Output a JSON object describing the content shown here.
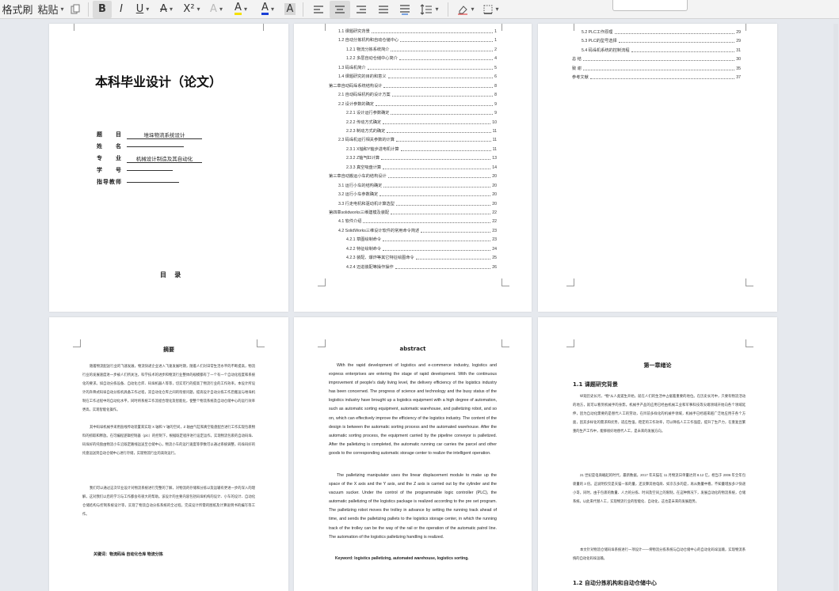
{
  "ribbon": {
    "format_painter": "格式刷",
    "paste": "粘贴",
    "bold": "B",
    "italic": "I",
    "underline": "U",
    "strikethrough": "A",
    "superscript": "X²",
    "text_effect": "A",
    "highlight": "A",
    "font_color": "A",
    "char_shading": "A",
    "caret": "▾"
  },
  "page_cover": {
    "title": "本科毕业设计（论文）",
    "fields": [
      {
        "label": "题　　目",
        "value": "堆垛物流系统设计"
      },
      {
        "label": "姓　　名",
        "value": ""
      },
      {
        "label": "专　　业",
        "value": "机械设计制造及其自动化"
      },
      {
        "label": "学　　号",
        "value": ""
      },
      {
        "label": "指导教师",
        "value": ""
      }
    ],
    "toc_heading": "目 录"
  },
  "page_toc1": {
    "entries": [
      {
        "text": "1.1 课题研究背景",
        "page": "1"
      },
      {
        "text": "1.2 自动分拣机构和自动仓储中心",
        "page": "1"
      },
      {
        "text": "1.2.1 物流分拣系统简介",
        "page": "2"
      },
      {
        "text": "1.2.2 多层自动仓储中心简介",
        "page": "4"
      },
      {
        "text": "1.3 码垛机简介",
        "page": "5"
      },
      {
        "text": "1.4 课题研究的目的和意义",
        "page": "6"
      },
      {
        "text": "第二章自动码垛系统结构设计",
        "page": "8"
      },
      {
        "text": "2.1 自动码垛机构的设计方案",
        "page": "8"
      },
      {
        "text": "2.2 设计参数的确定",
        "page": "9"
      },
      {
        "text": "2.2.1 设计运行参数确定",
        "page": "9"
      },
      {
        "text": "2.2.2 传动方式确定",
        "page": "10"
      },
      {
        "text": "2.2.3 制动方式的确定",
        "page": "11"
      },
      {
        "text": "2.3 码垛机运行相关参数的计算",
        "page": "11"
      },
      {
        "text": "2.3.1 X轴和Y轴步进电机计算",
        "page": "11"
      },
      {
        "text": "2.3.2 Z轴气缸计算",
        "page": "13"
      },
      {
        "text": "2.3.3 真空吸盘计算",
        "page": "14"
      },
      {
        "text": "第三章自动搬运小车的结构设计",
        "page": "20"
      },
      {
        "text": "3.1 运行小车的结构确定",
        "page": "20"
      },
      {
        "text": "3.2 运行小车参数确定",
        "page": "20"
      },
      {
        "text": "3.3 行走电机和驱动机计算选型",
        "page": "20"
      },
      {
        "text": "第四章solidworks三维建模及装配",
        "page": "22"
      },
      {
        "text": "4.1 软件介绍",
        "page": "22"
      },
      {
        "text": "4.2 SolidWorks三维设计软件的常用命令简述",
        "page": "23"
      },
      {
        "text": "4.2.1 草图绘制命令",
        "page": "23"
      },
      {
        "text": "4.2.2 特征绘制命令",
        "page": "24"
      },
      {
        "text": "4.2.3 装配、爆炸等其它特征绘图命令",
        "page": "25"
      },
      {
        "text": "4.2.4 迈进装配等操作操作",
        "page": "26"
      }
    ]
  },
  "page_toc2": {
    "entries": [
      {
        "text": "5.2 PLC工作原理",
        "page": "29"
      },
      {
        "text": "5.3 PLC的型号选择",
        "page": "29"
      },
      {
        "text": "5.4 码垛机系统的控制流程",
        "page": "31"
      },
      {
        "text": "总 结",
        "page": "30"
      },
      {
        "text": "致 谢",
        "page": "35"
      },
      {
        "text": "参考文献",
        "page": "37"
      }
    ]
  },
  "page_abstract_cn": {
    "heading": "摘要",
    "paragraphs": [
      "随着物流配送行业的飞速发展，物流快递企业进入飞速发展时期，随着人们对日常生活水平的不断提高，物流行业的发展速度进一步被人们所关注，科学技术的进步和物流行业整体的规模都有了一个有一个自动化程度和系统化的要求。如自动分拣设备、自动化仓库、码垛机器人等等，切实可行的提高了物流行业的工作效率。本设计所设计的升降式码垛自动分拣机具备工作过程，双自动化仓库之间的衔接问题，提高设计自动分拣工作后搬运与堆垛机制在工作过程中的自动化水平，同时将系统工作流程合理化及智能化，使整个物流系统及自动仓储中心的运行效率更高，实现智能化操作。",
      "其中码垛机械手采用直线传动装置来实现 X 轴和 Y 轴的空间，Z 轴由气缸和真空吸盘配合进行工作实现包裹物料的抓取和释放。在可编程逻辑控制器（plc）的控制下，根据既定程序进行设定运作，实现物流包裹的自动码垛、码垛好的托盘由物流小车沿既定路线运送至仓储中心，物流小车的运行速度等参数可以通过系统调整，码垛码好的托盘运送到自动仓储中心进行存储，实现物流行业的高效运行。",
      "我们可以通过这次毕业设计对物流系统进行完整的了解，对物流的存储和分拣以及运输有更进一步的深入的理解，这对我们以后的学习与工作都会有很大的帮助。该设计的主要内容包括码垛机构的设计、小车的设计、自动化仓储结构与控制系统设计等，实现了物流自动分拣系统的全过程，完成设计所需的图纸及计算说明书的编写等工作。"
    ],
    "keywords": "关键词：物流码垛  自动化仓库  物流分拣"
  },
  "page_abstract_en": {
    "heading": "abstract",
    "paragraphs": [
      "With the rapid development of logistics and e-commerce industry, logistics and express enterprises are entering the stage of rapid development. With the continuous improvement of people's daily living level, the delivery efficiency of the logistics industry has been concerned. The progress of science and technology and the busy status of the logistics industry have brought up a logistics equipment with a high degree of automation, such as automatic sorting equipment, automatic warehouse, and palletizing robot, and so on, which can effectively improve the efficiency of the logistics industry. The content of the design is between the automatic sorting process and the automated warehouse. After the automatic sorting process, the equipment carried by the pipeline conveyor is palletized. After the palletizing is completed, the automatic running car carries the parcel and other goods to the corresponding automatic storage center to realize the intelligent operation.",
      "The palletizing manipulator uses the linear displacement module to make up the space of the X axis and the Y axis, and the Z axis is carried out by the cylinder and the vacuum sucker. Under the control of the programmable logic controller (PLC), the automatic palletizing of the logistics package is realized according to the pre set program. The palletizing robot moves the trolley in advance by setting the running track ahead of time, and sends the palletizing pallets to the logistics storage center, in which the running track of the trolley can be the way of the rail or the operation of the automatic patrol line. The automation of the logistics palletizing handling is realized."
    ],
    "keywords": "Keyword: logistics palletizing, automated warehouse, logistics sorting."
  },
  "page_chapter1": {
    "chapter_title": "第一章绪论",
    "section_title": "1.1 课题研究背景",
    "paragraphs": [
      "纵观历史长河，“物”从人类诞生开始，就在人们的生活中占据着重要的地位。在历史长河中，只要有物流活动的地方，就可以看到机械手的身影。机械手产品的应用已经由机械工业和军事科技等尖端领域开始向各个领域延伸，因为自动化需要的是替代人工的劳动，在目前多样化的机械手领域，机械手已经越来越广泛地应用于各个方面，因其多样化的需求和优势，适应性强，稳定的工作效率，可以降低人工工作强度，提升了生产力，在重复且繁重的生产工作中，能够很好地替代人工，是未来的发展方向。",
      "21 世纪是电商崛起的时代，最新数据，2017 年天猫在 11 月物流日单量达到 8.12 亿，相当于 2006 年全年包裹量的 3 倍。这说明仅仅是天猫一家的量，还没算其他电商、如京东多的是，再从数量中看，不知量增加多少快递小哥，同时，由于包裹的数量、人力的分拣、时间及空间上的限制，在这种情况下，发展自动化的物流系统，仓储系统，以此来代替人工，实现物流行业的智能化、自动化，这也是未来的发展趋势。",
      "本文针对物流仓储码垛系统进行一项设计——将物流分拣系统与自动仓储中心的自动化码垛运输，实现物流系统的自动化码垛运输。"
    ],
    "next_section": "1.2 自动分拣机构和自动仓储中心"
  }
}
